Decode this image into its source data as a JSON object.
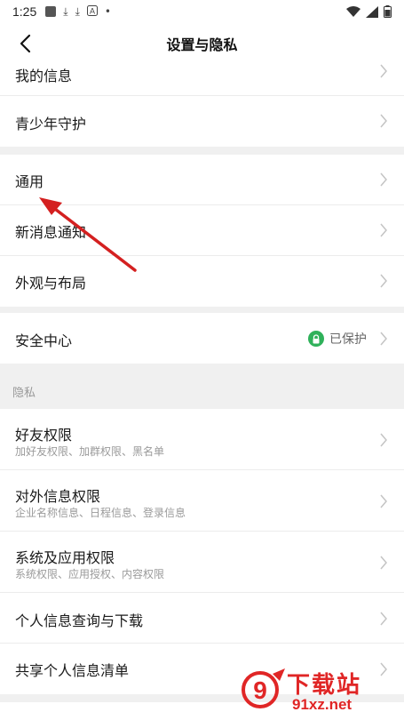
{
  "status_bar": {
    "time": "1:25",
    "icons": [
      "gallery-icon",
      "download-icon",
      "download-icon",
      "a-icon",
      "dot-icon"
    ],
    "right_icons": [
      "wifi-icon",
      "signal-icon",
      "battery-icon"
    ]
  },
  "nav": {
    "title": "设置与隐私",
    "back_icon": "back-arrow-icon"
  },
  "section1": [
    {
      "label": "我的信息"
    },
    {
      "label": "青少年守护"
    }
  ],
  "section2": [
    {
      "label": "通用"
    },
    {
      "label": "新消息通知"
    },
    {
      "label": "外观与布局"
    }
  ],
  "section3": {
    "label": "安全中心",
    "status": "已保护",
    "status_color": "#2fb15a"
  },
  "privacy": {
    "header": "隐私",
    "items": [
      {
        "label": "好友权限",
        "sub": "加好友权限、加群权限、黑名单"
      },
      {
        "label": "对外信息权限",
        "sub": "企业名称信息、日程信息、登录信息"
      },
      {
        "label": "系统及应用权限",
        "sub": "系统权限、应用授权、内容权限"
      },
      {
        "label": "个人信息查询与下载"
      },
      {
        "label": "共享个人信息清单"
      }
    ]
  },
  "watermark": {
    "brand": "下载站",
    "domain": "91xz.net",
    "logo_number": "9"
  },
  "colors": {
    "accent_arrow": "#d42020",
    "watermark_red": "#e02626",
    "chevron": "#c4c4c4"
  }
}
